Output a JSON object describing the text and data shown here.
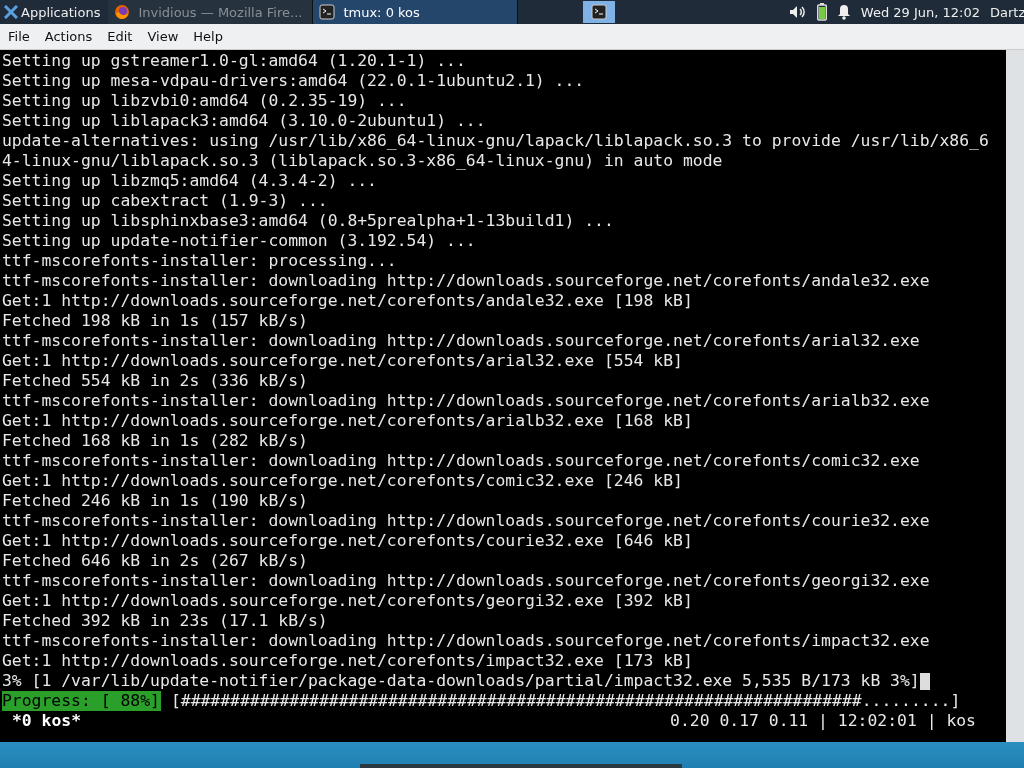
{
  "panel": {
    "apps_menu": "Applications",
    "tasks": [
      {
        "kind": "browser",
        "title": "Invidious — Mozilla Fire...",
        "selected": false
      },
      {
        "kind": "terminal",
        "title": "tmux: 0 kos",
        "selected": true
      }
    ],
    "launcher": {
      "highlighted": true
    },
    "clock": "Wed 29 Jun, 12:02",
    "user": "Dartz"
  },
  "menu_bar": [
    "File",
    "Actions",
    "Edit",
    "View",
    "Help"
  ],
  "terminal": {
    "lines": [
      "Setting up gstreamer1.0-gl:amd64 (1.20.1-1) ...",
      "Setting up mesa-vdpau-drivers:amd64 (22.0.1-1ubuntu2.1) ...",
      "Setting up libzvbi0:amd64 (0.2.35-19) ...",
      "Setting up liblapack3:amd64 (3.10.0-2ubuntu1) ...",
      "update-alternatives: using /usr/lib/x86_64-linux-gnu/lapack/liblapack.so.3 to provide /usr/lib/x86_6",
      "4-linux-gnu/liblapack.so.3 (liblapack.so.3-x86_64-linux-gnu) in auto mode",
      "Setting up libzmq5:amd64 (4.3.4-2) ...",
      "Setting up cabextract (1.9-3) ...",
      "Setting up libsphinxbase3:amd64 (0.8+5prealpha+1-13build1) ...",
      "Setting up update-notifier-common (3.192.54) ...",
      "ttf-mscorefonts-installer: processing...",
      "ttf-mscorefonts-installer: downloading http://downloads.sourceforge.net/corefonts/andale32.exe",
      "Get:1 http://downloads.sourceforge.net/corefonts/andale32.exe [198 kB]",
      "Fetched 198 kB in 1s (157 kB/s)",
      "ttf-mscorefonts-installer: downloading http://downloads.sourceforge.net/corefonts/arial32.exe",
      "Get:1 http://downloads.sourceforge.net/corefonts/arial32.exe [554 kB]",
      "Fetched 554 kB in 2s (336 kB/s)",
      "ttf-mscorefonts-installer: downloading http://downloads.sourceforge.net/corefonts/arialb32.exe",
      "Get:1 http://downloads.sourceforge.net/corefonts/arialb32.exe [168 kB]",
      "Fetched 168 kB in 1s (282 kB/s)",
      "ttf-mscorefonts-installer: downloading http://downloads.sourceforge.net/corefonts/comic32.exe",
      "Get:1 http://downloads.sourceforge.net/corefonts/comic32.exe [246 kB]",
      "Fetched 246 kB in 1s (190 kB/s)",
      "ttf-mscorefonts-installer: downloading http://downloads.sourceforge.net/corefonts/courie32.exe",
      "Get:1 http://downloads.sourceforge.net/corefonts/courie32.exe [646 kB]",
      "Fetched 646 kB in 2s (267 kB/s)",
      "ttf-mscorefonts-installer: downloading http://downloads.sourceforge.net/corefonts/georgi32.exe",
      "Get:1 http://downloads.sourceforge.net/corefonts/georgi32.exe [392 kB]",
      "Fetched 392 kB in 23s (17.1 kB/s)",
      "ttf-mscorefonts-installer: downloading http://downloads.sourceforge.net/corefonts/impact32.exe",
      "Get:1 http://downloads.sourceforge.net/corefonts/impact32.exe [173 kB]",
      "3% [1 /var/lib/update-notifier/package-data-downloads/partial/impact32.exe 5,535 B/173 kB 3%]"
    ],
    "progress": {
      "label": "Progress: [ 88%]",
      "bar": "[#####################################################################.........]"
    },
    "status": {
      "window": "*0 kos*",
      "right": "0.20 0.17 0.11 | 12:02:01 | kos"
    }
  }
}
